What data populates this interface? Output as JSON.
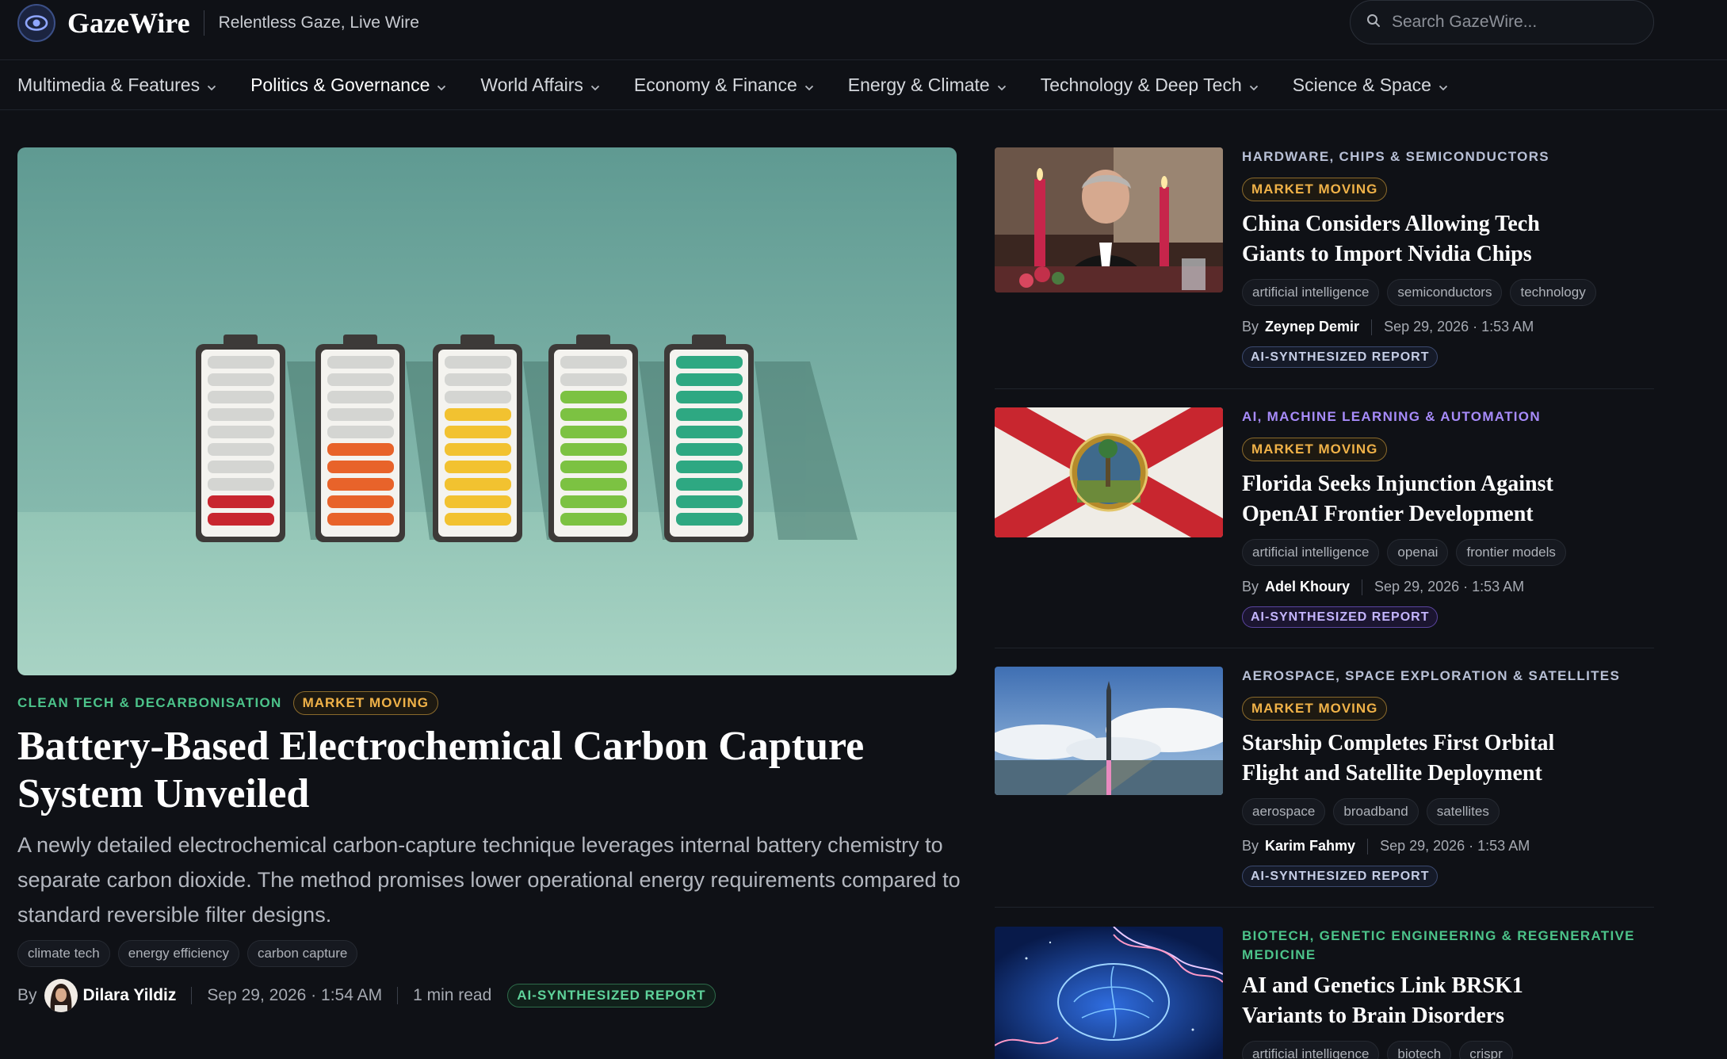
{
  "brand": {
    "name": "GazeWire",
    "tagline": "Relentless Gaze, Live Wire"
  },
  "search": {
    "placeholder": "Search GazeWire..."
  },
  "nav": [
    {
      "label": "Multimedia & Features"
    },
    {
      "label": "Politics & Governance"
    },
    {
      "label": "World Affairs"
    },
    {
      "label": "Economy & Finance"
    },
    {
      "label": "Energy & Climate"
    },
    {
      "label": "Technology & Deep Tech"
    },
    {
      "label": "Science & Space"
    }
  ],
  "hero": {
    "category": "CLEAN TECH & DECARBONISATION",
    "badge": "MARKET MOVING",
    "title": "Battery-Based Electrochemical Carbon Capture System Unveiled",
    "summary": "A newly detailed electrochemical carbon-capture technique leverages internal battery chemistry to separate carbon dioxide. The method promises lower operational energy requirements compared to standard reversible filter designs.",
    "tags": [
      "climate tech",
      "energy efficiency",
      "carbon capture"
    ],
    "by": "By",
    "author": "Dilara Yildiz",
    "date": "Sep 29, 2026 · 1:54 AM",
    "read_time": "1 min read",
    "ai_label": "AI-SYNTHESIZED REPORT"
  },
  "articles": [
    {
      "category": "HARDWARE, CHIPS & SEMICONDUCTORS",
      "badge": "MARKET MOVING",
      "title": "China Considers Allowing Tech Giants to Import Nvidia Chips",
      "tags": [
        "artificial intelligence",
        "semiconductors",
        "technology"
      ],
      "by": "By",
      "author": "Zeynep Demir",
      "date": "Sep 29, 2026 · 1:53 AM",
      "ai_label": "AI-SYNTHESIZED REPORT"
    },
    {
      "category": "AI, MACHINE LEARNING & AUTOMATION",
      "badge": "MARKET MOVING",
      "title": "Florida Seeks Injunction Against OpenAI Frontier Development",
      "tags": [
        "artificial intelligence",
        "openai",
        "frontier models"
      ],
      "by": "By",
      "author": "Adel Khoury",
      "date": "Sep 29, 2026 · 1:53 AM",
      "ai_label": "AI-SYNTHESIZED REPORT"
    },
    {
      "category": "AEROSPACE, SPACE EXPLORATION & SATELLITES",
      "badge": "MARKET MOVING",
      "title": "Starship Completes First Orbital Flight and Satellite Deployment",
      "tags": [
        "aerospace",
        "broadband",
        "satellites"
      ],
      "by": "By",
      "author": "Karim Fahmy",
      "date": "Sep 29, 2026 · 1:53 AM",
      "ai_label": "AI-SYNTHESIZED REPORT"
    },
    {
      "category": "BIOTECH, GENETIC ENGINEERING & REGENERATIVE MEDICINE",
      "title": "AI and Genetics Link BRSK1 Variants to Brain Disorders",
      "tags": [
        "artificial intelligence",
        "biotech",
        "crispr"
      ]
    }
  ]
}
